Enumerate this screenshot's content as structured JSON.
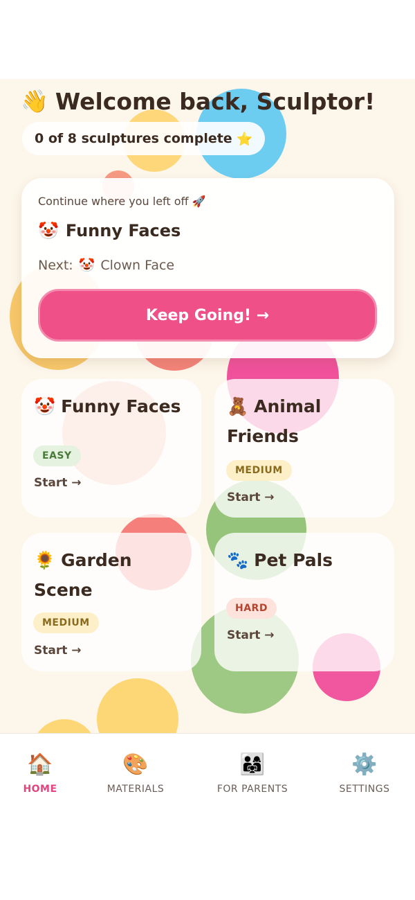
{
  "header": {
    "wave_icon": "👋",
    "title": "Welcome back, Sculptor!",
    "progress_text": "0 of 8 sculptures complete",
    "progress_icon": "⭐"
  },
  "continue_card": {
    "label": "Continue where you left off",
    "label_icon": "🚀",
    "title_icon": "🤡",
    "title": "Funny Faces",
    "next_label": "Next:",
    "next_icon": "🤡",
    "next_value": "Clown Face",
    "button_label": "Keep Going! →"
  },
  "projects": [
    {
      "icon": "🤡",
      "title": "Funny Faces",
      "difficulty": "EASY",
      "start_label": "Start →"
    },
    {
      "icon": "🧸",
      "title": "Animal Friends",
      "difficulty": "MEDIUM",
      "start_label": "Start →"
    },
    {
      "icon": "🌻",
      "title": "Garden Scene",
      "difficulty": "MEDIUM",
      "start_label": "Start →"
    },
    {
      "icon": "🐾",
      "title": "Pet Pals",
      "difficulty": "HARD",
      "start_label": "Start →"
    }
  ],
  "tabs": [
    {
      "icon": "🏠",
      "label": "HOME",
      "active": true
    },
    {
      "icon": "🎨",
      "label": "MATERIALS",
      "active": false
    },
    {
      "icon": "👨‍👩‍👧",
      "label": "FOR PARENTS",
      "active": false
    },
    {
      "icon": "⚙️",
      "label": "SETTINGS",
      "active": false
    }
  ],
  "colors": {
    "accent": "#ee5087",
    "background": "#fdf6ea",
    "easy_badge": "#e4f2df",
    "medium_badge": "#fdf0c9",
    "hard_badge": "#fde3dc"
  }
}
